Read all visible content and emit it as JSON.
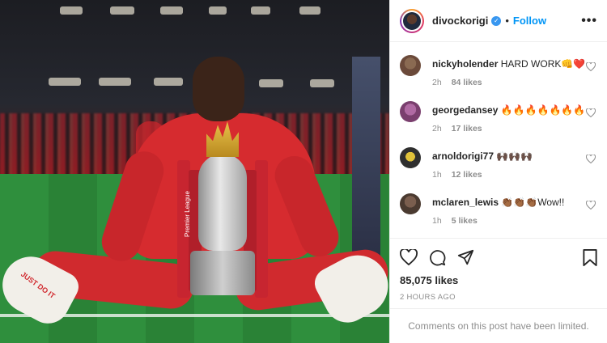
{
  "post": {
    "username": "divockorigi",
    "follow_label": "Follow",
    "separator": "•",
    "verified_mark": "✓",
    "more_label": "•••",
    "photo_alt": "Player sitting on the pitch with the Premier League trophy"
  },
  "photo_text": {
    "trophy_ribbon": "Premier League",
    "boot_text": "JUST DO IT"
  },
  "comments": [
    {
      "username": "nickyholender",
      "text": "HARD WORK👊❤️",
      "time": "2h",
      "likes": "84 likes",
      "avatar_color": "#6b4a3a"
    },
    {
      "username": "georgedansey",
      "text": "🔥🔥🔥🔥🔥🔥🔥",
      "time": "2h",
      "likes": "17 likes",
      "avatar_color": "#7a3f6e"
    },
    {
      "username": "arnoldorigi77",
      "text": "🙌🏿🙌🏿🙌🏿",
      "time": "1h",
      "likes": "12 likes",
      "avatar_color": "#2f2f2f"
    },
    {
      "username": "mclaren_lewis",
      "text": "👏🏾👏🏾👏🏾Wow!!",
      "time": "1h",
      "likes": "5 likes",
      "avatar_color": "#4a3a30"
    }
  ],
  "stats": {
    "likes": "85,075 likes",
    "time_ago": "2 HOURS AGO"
  },
  "footer": {
    "limited_text": "Comments on this post have been limited."
  },
  "icons": [
    "heart-icon",
    "comment-icon",
    "share-icon",
    "bookmark-icon"
  ]
}
